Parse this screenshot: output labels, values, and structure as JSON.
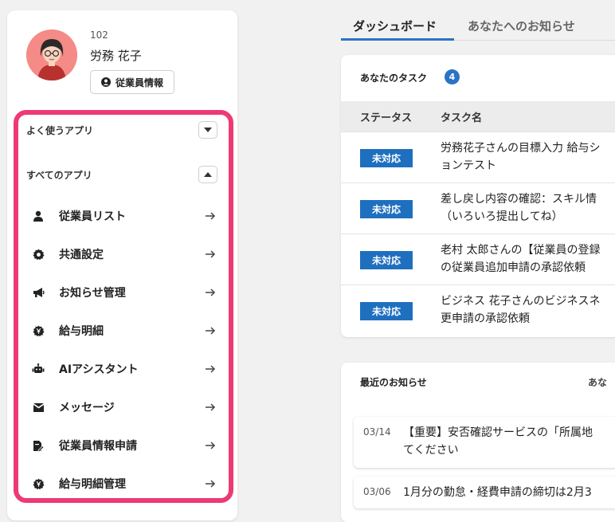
{
  "profile": {
    "employee_no": "102",
    "name": "労務 花子",
    "info_button": "従業員情報",
    "avatar_bg": "#f48b86"
  },
  "sidebar": {
    "frequent_title": "よく使うアプリ",
    "all_title": "すべてのアプリ",
    "highlight_color": "#ee3a74",
    "items": [
      {
        "label": "従業員リスト",
        "icon": "person-icon"
      },
      {
        "label": "共通設定",
        "icon": "gear-icon"
      },
      {
        "label": "お知らせ管理",
        "icon": "megaphone-icon"
      },
      {
        "label": "給与明細",
        "icon": "yen-gear-icon"
      },
      {
        "label": "AIアシスタント",
        "icon": "robot-icon"
      },
      {
        "label": "メッセージ",
        "icon": "envelope-icon"
      },
      {
        "label": "従業員情報申請",
        "icon": "document-edit-icon"
      },
      {
        "label": "給与明細管理",
        "icon": "yen-gear-icon"
      }
    ]
  },
  "tabs": [
    {
      "label": "ダッシュボード",
      "active": true
    },
    {
      "label": "あなたへのお知らせ",
      "active": false
    }
  ],
  "tasks": {
    "title": "あなたのタスク",
    "count": "4",
    "columns": [
      "ステータス",
      "タスク名"
    ],
    "rows": [
      {
        "status": "未対応",
        "line1": "労務花子さんの目標入力 給与シ",
        "line2": "ョンテスト"
      },
      {
        "status": "未対応",
        "line1": "差し戻し内容の確認：スキル情",
        "line2": "（いろいろ提出してね）"
      },
      {
        "status": "未対応",
        "line1": "老村 太郎さんの【従業員の登録",
        "line2": "の従業員追加申請の承認依頼"
      },
      {
        "status": "未対応",
        "line1": "ビジネス 花子さんのビジネスネ",
        "line2": "更申請の承認依頼"
      }
    ],
    "accent": "#1f6fbf"
  },
  "news": {
    "title": "最近のお知らせ",
    "right_label": "あな",
    "items": [
      {
        "date": "03/14",
        "line1": "【重要】安否確認サービスの「所属地",
        "line2": "てください"
      },
      {
        "date": "03/06",
        "line1": "1月分の勤怠・経費申請の締切は2月3",
        "line2": ""
      }
    ]
  }
}
